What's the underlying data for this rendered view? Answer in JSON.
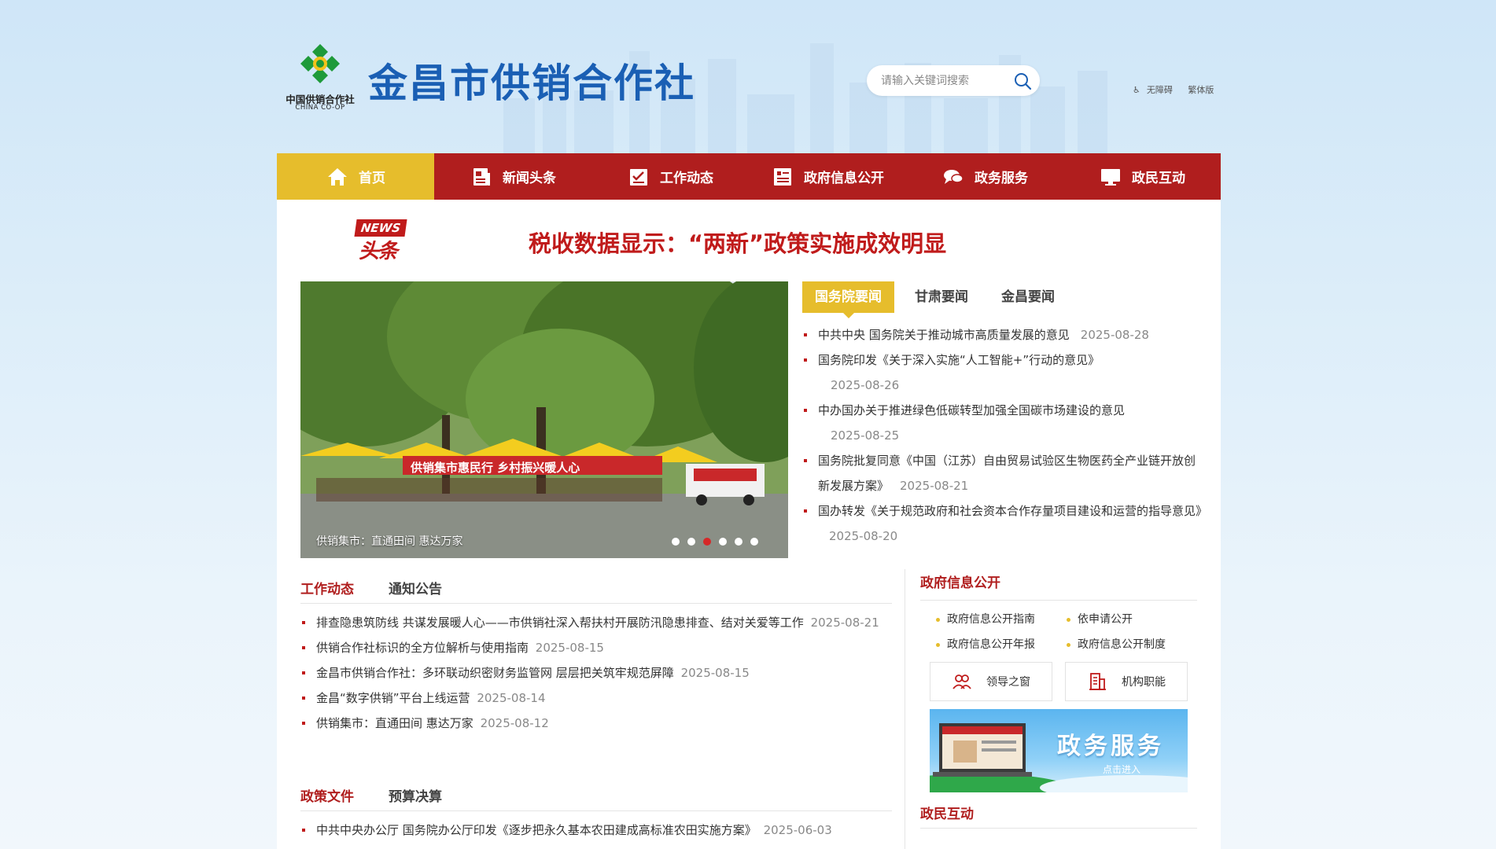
{
  "header": {
    "logo_cn": "中国供销合作社",
    "logo_en": "CHINA CO-OP",
    "site_title": "金昌市供销合作社",
    "search_placeholder": "请输入关键词搜索",
    "accessibility": "无障碍",
    "traditional": "繁体版"
  },
  "nav": [
    {
      "label": "首页",
      "icon": "home-icon",
      "active": true
    },
    {
      "label": "新闻头条",
      "icon": "newspaper-icon"
    },
    {
      "label": "工作动态",
      "icon": "checklist-icon"
    },
    {
      "label": "政府信息公开",
      "icon": "document-list-icon"
    },
    {
      "label": "政务服务",
      "icon": "chat-bubbles-icon"
    },
    {
      "label": "政民互动",
      "icon": "monitor-icon"
    }
  ],
  "headline": {
    "badge_top": "NEWS",
    "badge_bottom": "头条",
    "text": "税收数据显示：“两新”政策实施成效明显"
  },
  "slideshow": {
    "caption": "供销集市：直通田间 惠达万家",
    "banner_text": "供销集市惠民行 乡村振兴暖人心",
    "dot_count": 6,
    "active_dot": 3
  },
  "news_tabs": {
    "tabs": [
      "国务院要闻",
      "甘肃要闻",
      "金昌要闻"
    ],
    "active": 0,
    "items": [
      {
        "title": "中共中央 国务院关于推动城市高质量发展的意见",
        "date": "2025-08-28"
      },
      {
        "title": "国务院印发《关于深入实施“人工智能+”行动的意见》",
        "date": "2025-08-26"
      },
      {
        "title": "中办国办关于推进绿色低碳转型加强全国碳市场建设的意见",
        "date": "2025-08-25"
      },
      {
        "title": "国务院批复同意《中国（江苏）自由贸易试验区生物医药全产业链开放创新发展方案》",
        "date": "2025-08-21"
      },
      {
        "title": "国办转发《关于规范政府和社会资本合作存量项目建设和运营的指导意见》",
        "date": "2025-08-20"
      }
    ]
  },
  "work_section": {
    "tabs": [
      "工作动态",
      "通知公告"
    ],
    "items": [
      {
        "title": "排查隐患筑防线 共谋发展暖人心——市供销社深入帮扶村开展防汛隐患排查、结对关爱等工作",
        "date": "2025-08-21"
      },
      {
        "title": "供销合作社标识的全方位解析与使用指南",
        "date": "2025-08-15"
      },
      {
        "title": "金昌市供销合作社：多环联动织密财务监管网 层层把关筑牢规范屏障",
        "date": "2025-08-15"
      },
      {
        "title": "金昌“数字供销”平台上线运营",
        "date": "2025-08-14"
      },
      {
        "title": "供销集市：直通田间 惠达万家",
        "date": "2025-08-12"
      }
    ]
  },
  "policy_section": {
    "tabs": [
      "政策文件",
      "预算决算"
    ],
    "items": [
      {
        "title": "中共中央办公厅 国务院办公厅印发《逐步把永久基本农田建成高标准农田实施方案》",
        "date": "2025-06-03"
      }
    ]
  },
  "gov_info": {
    "title": "政府信息公开",
    "links": [
      "政府信息公开指南",
      "依申请公开",
      "政府信息公开年报",
      "政府信息公开制度"
    ],
    "buttons": [
      {
        "label": "领导之窗",
        "icon": "people-icon"
      },
      {
        "label": "机构职能",
        "icon": "building-icon"
      }
    ],
    "service_banner": {
      "title": "政务服务",
      "sub": "点击进入"
    }
  },
  "interaction": {
    "title": "政民互动"
  },
  "colors": {
    "brand_red": "#b01e1e",
    "accent_gold": "#e6bd2c",
    "title_blue": "#1a5fb4"
  }
}
